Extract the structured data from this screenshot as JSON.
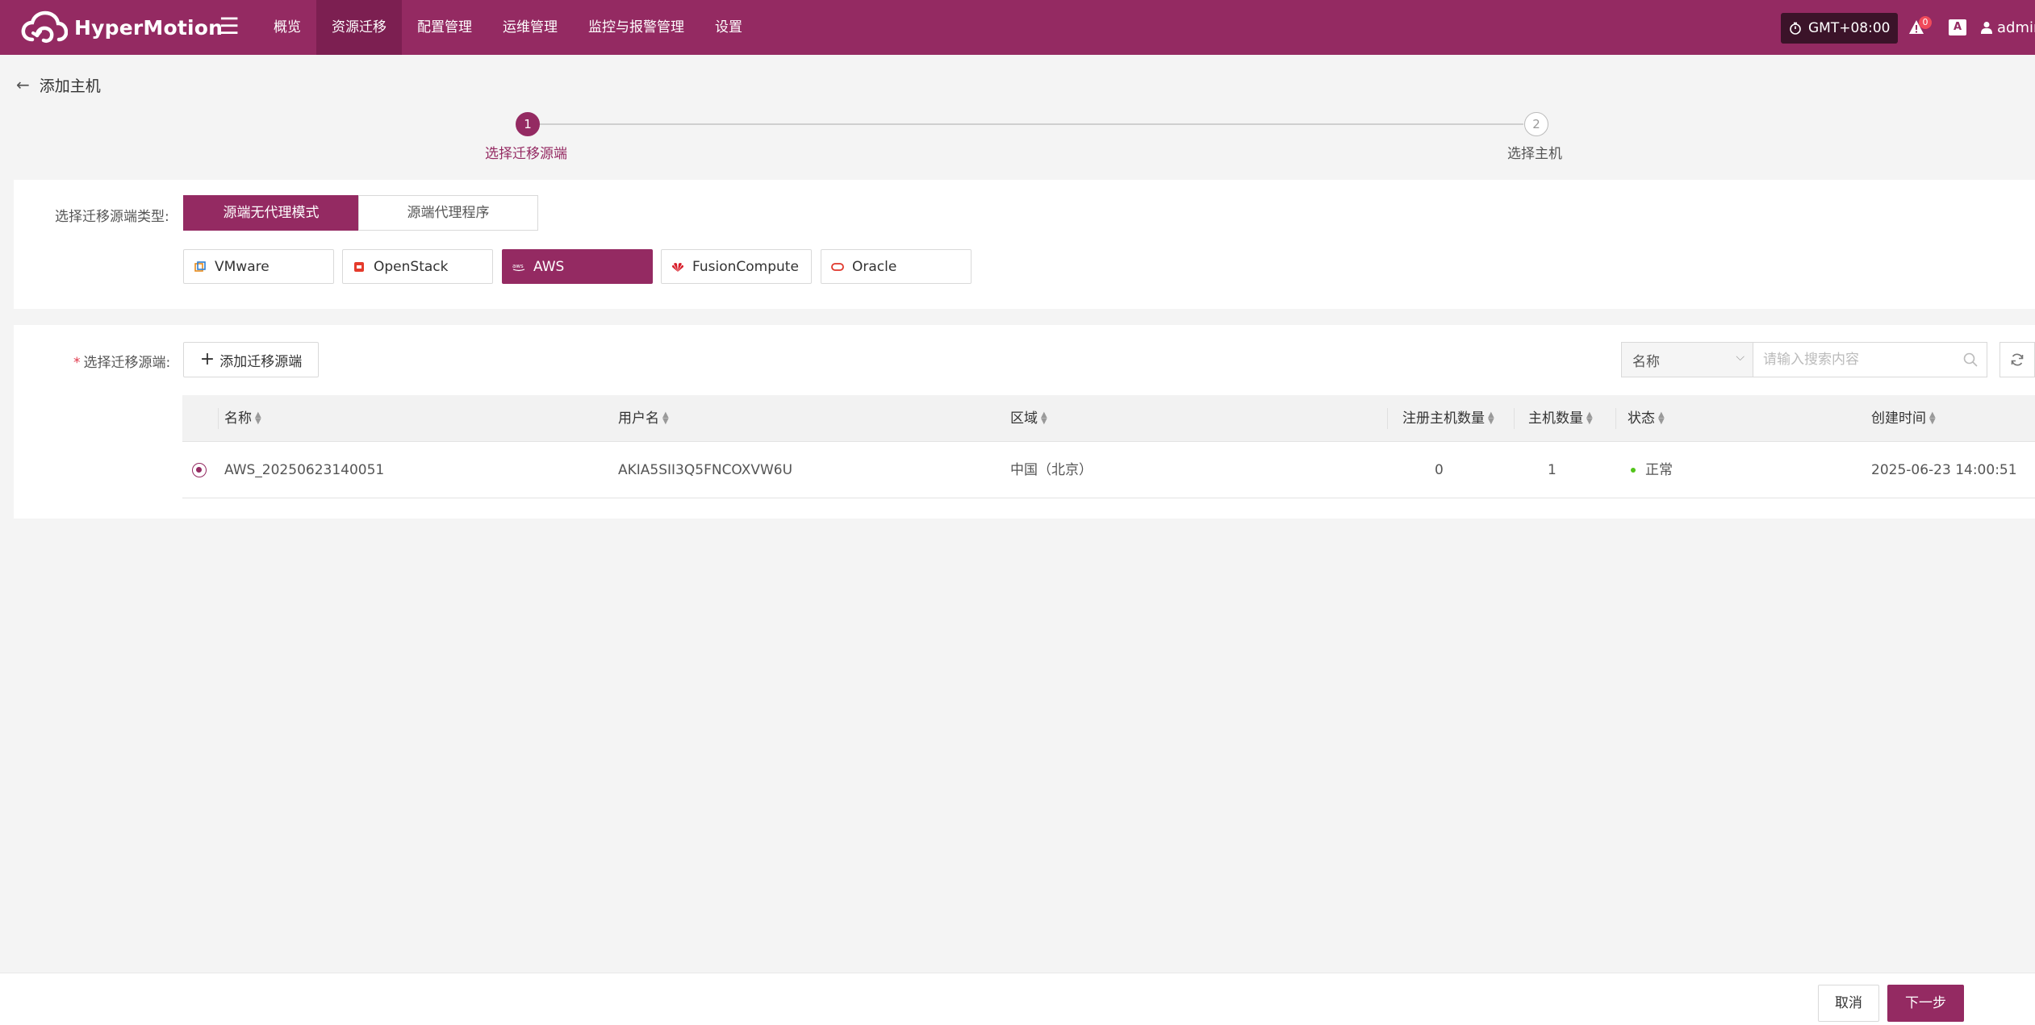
{
  "app": {
    "brand": "HyperMotion"
  },
  "nav": {
    "items": [
      {
        "label": "概览"
      },
      {
        "label": "资源迁移"
      },
      {
        "label": "配置管理"
      },
      {
        "label": "运维管理"
      },
      {
        "label": "监控与报警管理"
      },
      {
        "label": "设置"
      }
    ],
    "active_index": 1
  },
  "header": {
    "timezone": "GMT+08:00",
    "notification_count": "0",
    "lang_icon": "A",
    "user": "admin"
  },
  "page": {
    "title": "添加主机"
  },
  "steps": [
    {
      "number": "1",
      "label": "选择迁移源端",
      "state": "active"
    },
    {
      "number": "2",
      "label": "选择主机",
      "state": "pending"
    }
  ],
  "source_type": {
    "label": "选择迁移源端类型:",
    "modes": [
      {
        "label": "源端无代理模式",
        "selected": true
      },
      {
        "label": "源端代理程序",
        "selected": false
      }
    ],
    "platforms": [
      {
        "label": "VMware",
        "icon": "vmware-icon",
        "selected": false
      },
      {
        "label": "OpenStack",
        "icon": "openstack-icon",
        "selected": false
      },
      {
        "label": "AWS",
        "icon": "aws-icon",
        "selected": true
      },
      {
        "label": "FusionCompute",
        "icon": "huawei-icon",
        "selected": false
      },
      {
        "label": "Oracle",
        "icon": "oracle-icon",
        "selected": false
      }
    ]
  },
  "source": {
    "label": "选择迁移源端:",
    "required_mark": "*",
    "add_button": "添加迁移源端",
    "search": {
      "field": "名称",
      "placeholder": "请输入搜索内容"
    },
    "table": {
      "columns": [
        "名称",
        "用户名",
        "区域",
        "注册主机数量",
        "主机数量",
        "状态",
        "创建时间"
      ],
      "rows": [
        {
          "selected": true,
          "name": "AWS_20250623140051",
          "username": "AKIA5SII3Q5FNCOXVW6U",
          "region": "中国（北京）",
          "registered_hosts": "0",
          "hosts": "1",
          "status": "正常",
          "created": "2025-06-23 14:00:51"
        }
      ]
    }
  },
  "footer": {
    "cancel": "取消",
    "next": "下一步"
  },
  "colors": {
    "brand": "#942a62",
    "nav_active": "#7c1f51",
    "status_ok": "#52c41a",
    "badge": "#f04a5a"
  }
}
